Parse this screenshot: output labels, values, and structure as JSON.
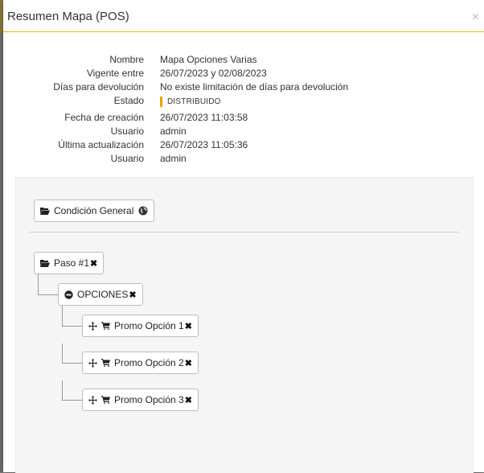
{
  "modal": {
    "title": "Resumen Mapa (POS)",
    "close_glyph": "×"
  },
  "details": {
    "rows": [
      {
        "label": "Nombre",
        "value": "Mapa Opciones Varias"
      },
      {
        "label": "Vigente entre",
        "value": "26/07/2023 y 02/08/2023"
      },
      {
        "label": "Días para devolución",
        "value": "No existe limitación de días para devolución"
      },
      {
        "label": "Estado",
        "value": "DISTRIBUIDO"
      },
      {
        "label": "Fecha de creación",
        "value": "26/07/2023 11:03:58"
      },
      {
        "label": "Usuario",
        "value": "admin"
      },
      {
        "label": "Última actualización",
        "value": "26/07/2023 11:05:36"
      },
      {
        "label": "Usuario",
        "value": "admin"
      }
    ],
    "status_color": "#e8a300"
  },
  "tree": {
    "general": {
      "label": "Condición General",
      "icon": "folder-open-icon",
      "extra_icon": "globe-icon"
    },
    "step": {
      "label": "Paso #1",
      "icon": "folder-open-icon",
      "remove_glyph": "✖"
    },
    "options": {
      "label": "OPCIONES",
      "icon": "minus-circle-icon",
      "remove_glyph": "✖"
    },
    "promos": [
      {
        "label": "Promo Opción 1",
        "remove_glyph": "✖"
      },
      {
        "label": "Promo Opción 2",
        "remove_glyph": "✖"
      },
      {
        "label": "Promo Opción 3",
        "remove_glyph": "✖"
      }
    ]
  },
  "colors": {
    "accent": "#e5c100",
    "panel_bg": "#f5f5f5"
  }
}
